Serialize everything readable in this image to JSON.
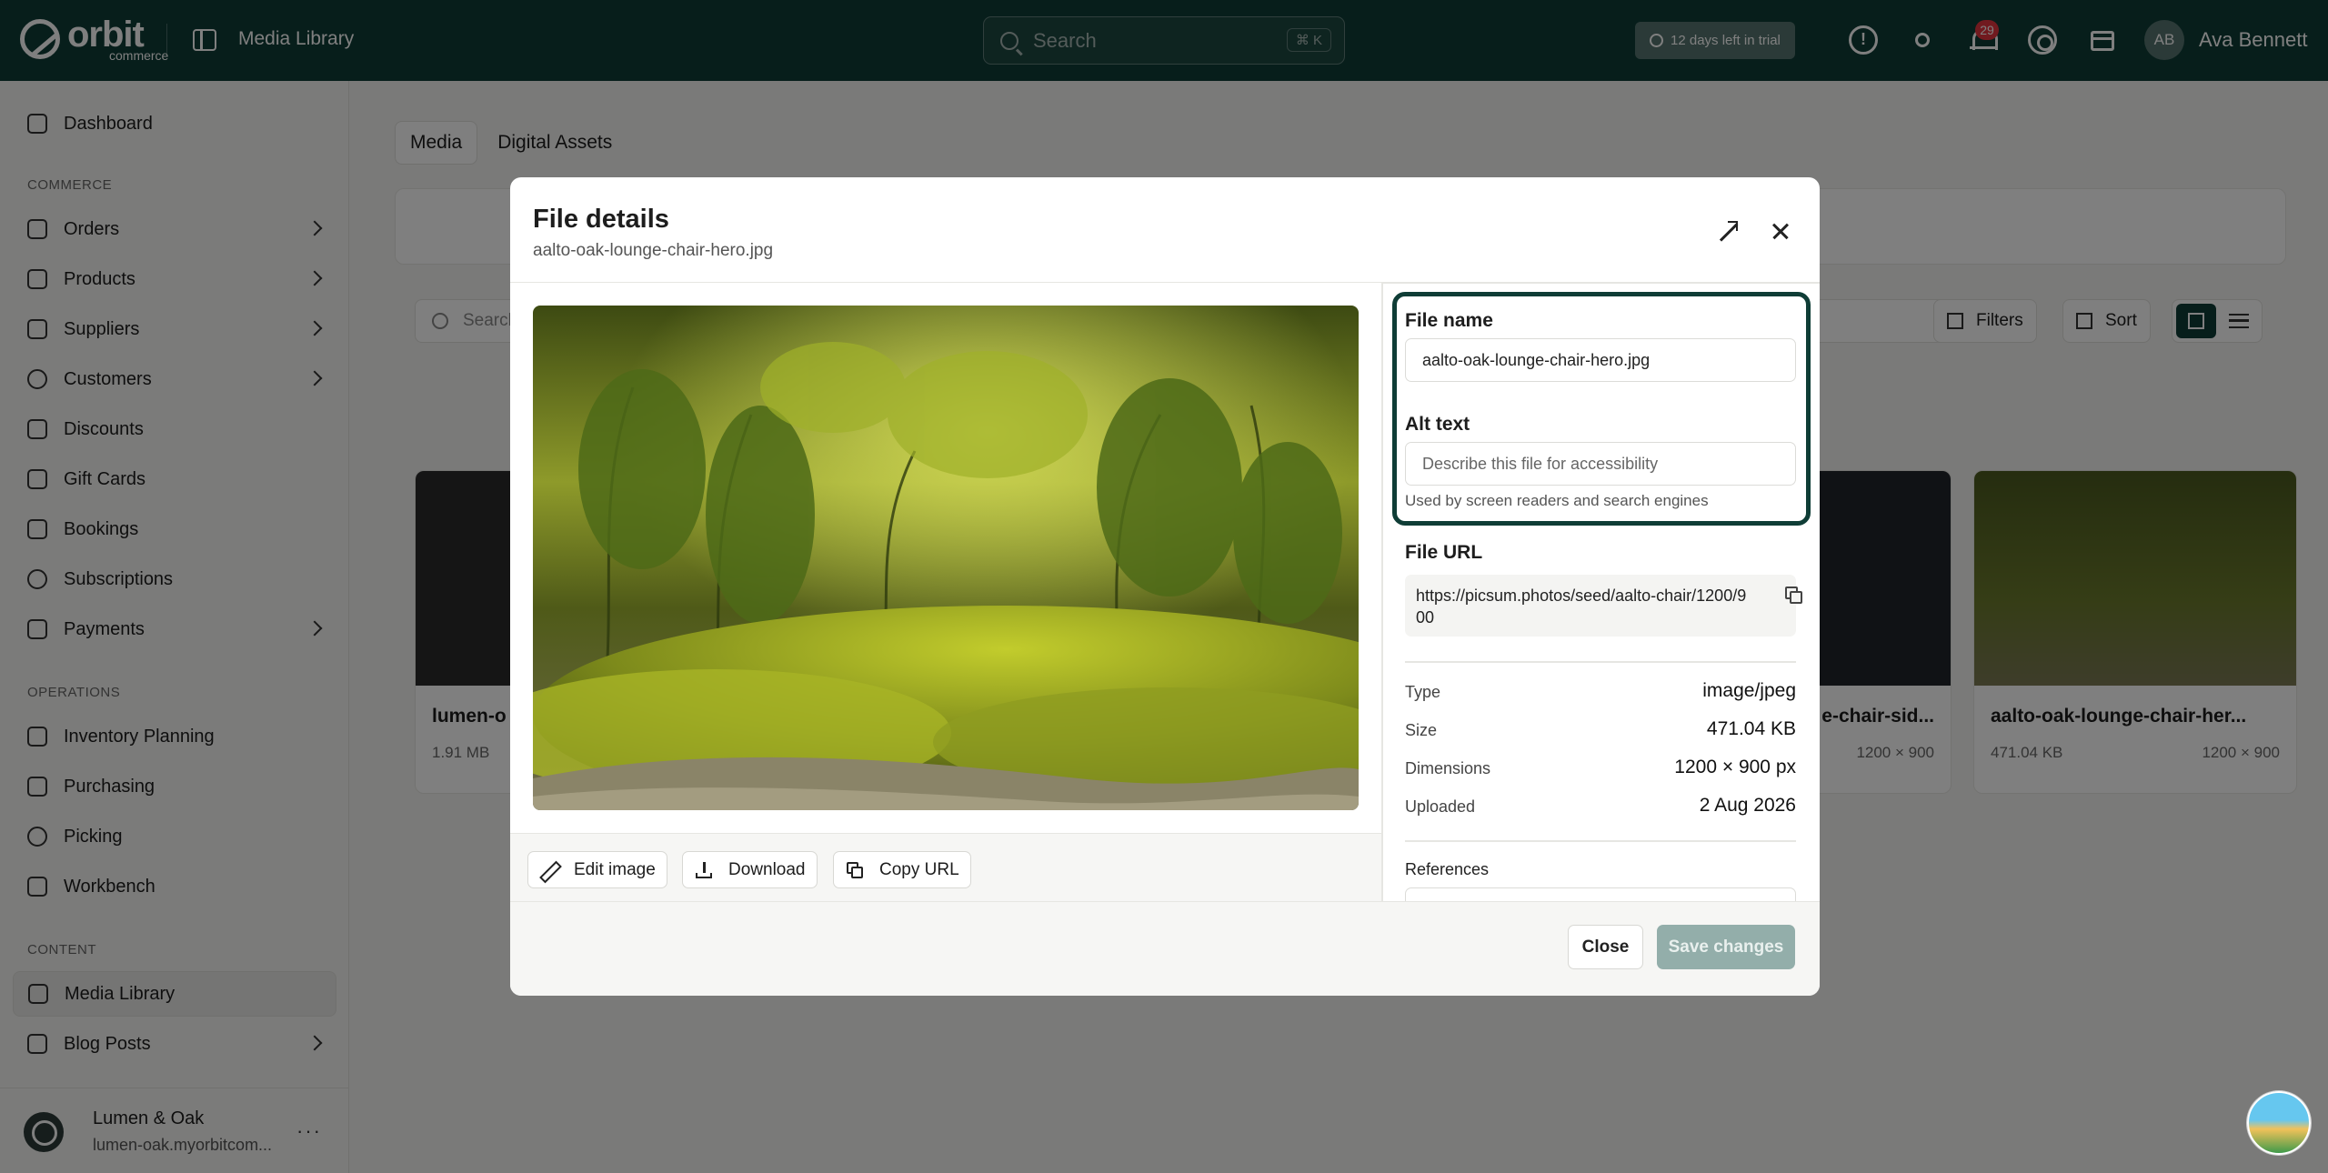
{
  "topbar": {
    "logo_text": "orbit",
    "logo_sub": "commerce",
    "app_title": "Media Library",
    "search_placeholder": "Search",
    "search_shortcut": "⌘ K",
    "trial_text": "12 days left in trial",
    "notification_count": "29",
    "user_initials": "AB",
    "user_name": "Ava Bennett"
  },
  "sidebar": {
    "dashboard": "Dashboard",
    "section_commerce": "COMMERCE",
    "commerce_items": [
      "Orders",
      "Products",
      "Suppliers",
      "Customers",
      "Discounts",
      "Gift Cards",
      "Bookings",
      "Subscriptions",
      "Payments"
    ],
    "section_operations": "OPERATIONS",
    "operations_items": [
      "Inventory Planning",
      "Purchasing",
      "Picking",
      "Workbench"
    ],
    "section_content": "CONTENT",
    "content_items": [
      "Media Library",
      "Blog Posts"
    ],
    "store_name": "Lumen & Oak",
    "store_url": "lumen-oak.myorbitcom..."
  },
  "main": {
    "tabs": [
      "Media",
      "Digital Assets"
    ],
    "grid_search_placeholder": "Search",
    "filters_label": "Filters",
    "sort_label": "Sort",
    "cards": [
      {
        "name": "lumen-o",
        "size": "1.91 MB",
        "dims": ""
      },
      {
        "name": "e-chair-sid...",
        "size": "",
        "dims": "1200 × 900"
      },
      {
        "name": "aalto-oak-lounge-chair-her...",
        "size": "471.04 KB",
        "dims": "1200 × 900"
      }
    ]
  },
  "modal": {
    "title": "File details",
    "subtitle": "aalto-oak-lounge-chair-hero.jpg",
    "actions": {
      "edit": "Edit image",
      "download": "Download",
      "copy_url": "Copy URL"
    },
    "file_name_label": "File name",
    "file_name_value": "aalto-oak-lounge-chair-hero.jpg",
    "alt_text_label": "Alt text",
    "alt_text_placeholder": "Describe this file for accessibility",
    "alt_text_help": "Used by screen readers and search engines",
    "file_url_label": "File URL",
    "file_url_value": "https://picsum.photos/seed/aalto-chair/1200/900",
    "meta": [
      {
        "key": "Type",
        "value": "image/jpeg"
      },
      {
        "key": "Size",
        "value": "471.04 KB"
      },
      {
        "key": "Dimensions",
        "value": "1200 × 900 px"
      },
      {
        "key": "Uploaded",
        "value": "2 Aug 2026"
      }
    ],
    "references_label": "References",
    "close_label": "Close",
    "save_label": "Save changes"
  },
  "colors": {
    "brand": "#0f3d36",
    "save_disabled": "#93aeaa",
    "badge": "#e3343f"
  }
}
